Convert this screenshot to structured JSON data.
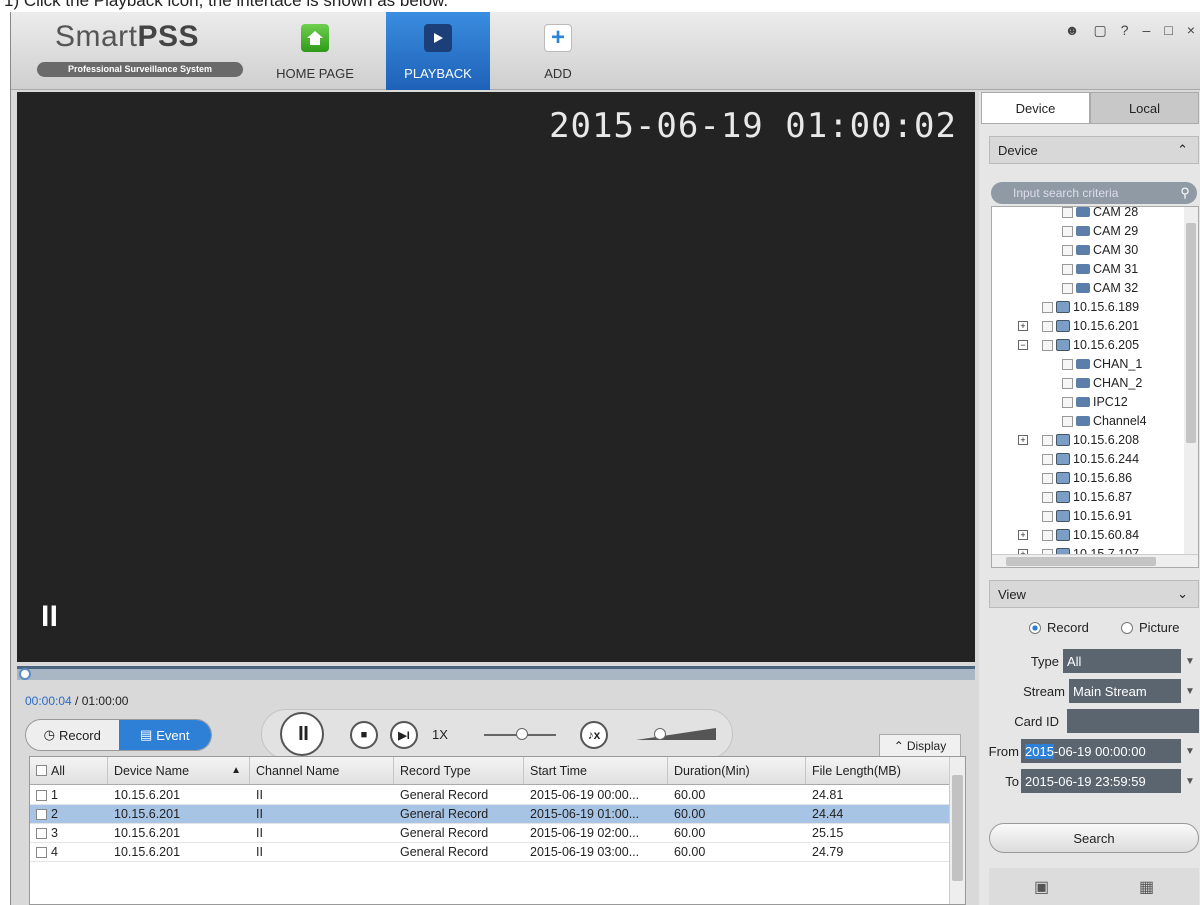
{
  "top_strip_text": "1) Click the Playback icon, the intertace is shown as below.",
  "app": {
    "logo_main": "Smart",
    "logo_bold": "PSS",
    "logo_sub": "Professional Surveillance System"
  },
  "nav": [
    {
      "label": "HOME PAGE",
      "icon": "home-icon"
    },
    {
      "label": "PLAYBACK",
      "icon": "playback-icon"
    },
    {
      "label": "ADD",
      "icon": "plus-icon"
    }
  ],
  "window_controls": [
    "user-icon",
    "lock-icon",
    "help-icon",
    "minimize-icon",
    "maximize-icon",
    "close-icon"
  ],
  "video": {
    "osd_timestamp": "2015-06-19 01:00:02",
    "paused": true
  },
  "timeline": {
    "current": "00:00:04",
    "total": "01:00:00",
    "separator": " / ",
    "progress": 0.001
  },
  "mode_toggle": {
    "record_label": "Record",
    "event_label": "Event",
    "active": "Event"
  },
  "playback": {
    "speed": "1X",
    "speed_slider": 0.4,
    "volume_slider": 0.3
  },
  "display_tab": "Display",
  "table": {
    "headers": [
      "All",
      "Device Name",
      "Channel Name",
      "Record Type",
      "Start Time",
      "Duration(Min)",
      "File Length(MB)"
    ],
    "rows": [
      [
        "1",
        "10.15.6.201",
        "II",
        "General Record",
        "2015-06-19 00:00...",
        "60.00",
        "24.81"
      ],
      [
        "2",
        "10.15.6.201",
        "II",
        "General Record",
        "2015-06-19 01:00...",
        "60.00",
        "24.44"
      ],
      [
        "3",
        "10.15.6.201",
        "II",
        "General Record",
        "2015-06-19 02:00...",
        "60.00",
        "25.15"
      ],
      [
        "4",
        "10.15.6.201",
        "II",
        "General Record",
        "2015-06-19 03:00...",
        "60.00",
        "24.79"
      ]
    ],
    "selected_row": 1
  },
  "panel": {
    "tabs": [
      "Device",
      "Local"
    ],
    "device_header": "Device",
    "search_placeholder": "Input search criteria",
    "tree": [
      {
        "label": "CAM 28",
        "kind": "cam",
        "level": 3
      },
      {
        "label": "CAM 29",
        "kind": "cam",
        "level": 3
      },
      {
        "label": "CAM 30",
        "kind": "cam",
        "level": 3
      },
      {
        "label": "CAM 31",
        "kind": "cam",
        "level": 3
      },
      {
        "label": "CAM 32",
        "kind": "cam",
        "level": 3
      },
      {
        "label": "10.15.6.189",
        "kind": "dev",
        "level": 2
      },
      {
        "label": "10.15.6.201",
        "kind": "dev",
        "level": 2,
        "expander": "+"
      },
      {
        "label": "10.15.6.205",
        "kind": "dev",
        "level": 2,
        "expander": "-"
      },
      {
        "label": "CHAN_1",
        "kind": "cam",
        "level": 3
      },
      {
        "label": "CHAN_2",
        "kind": "cam",
        "level": 3
      },
      {
        "label": "IPC12",
        "kind": "cam",
        "level": 3
      },
      {
        "label": "Channel4",
        "kind": "cam",
        "level": 3
      },
      {
        "label": "10.15.6.208",
        "kind": "dev",
        "level": 2,
        "expander": "+"
      },
      {
        "label": "10.15.6.244",
        "kind": "dev",
        "level": 2
      },
      {
        "label": "10.15.6.86",
        "kind": "dev",
        "level": 2
      },
      {
        "label": "10.15.6.87",
        "kind": "dev",
        "level": 2
      },
      {
        "label": "10.15.6.91",
        "kind": "dev",
        "level": 2
      },
      {
        "label": "10.15.60.84",
        "kind": "dev",
        "level": 2,
        "expander": "+"
      },
      {
        "label": "10.15.7.107",
        "kind": "dev",
        "level": 2,
        "expander": "+"
      }
    ],
    "view_header": "View",
    "record_label": "Record",
    "picture_label": "Picture",
    "type_label": "Type",
    "type_value": "All",
    "stream_label": "Stream",
    "stream_value": "Main Stream",
    "cardid_label": "Card ID",
    "from_label": "From",
    "from_year": "2015",
    "from_rest": "-06-19 00:00:00",
    "to_label": "To",
    "to_value": "2015-06-19 23:59:59",
    "search_button": "Search"
  }
}
